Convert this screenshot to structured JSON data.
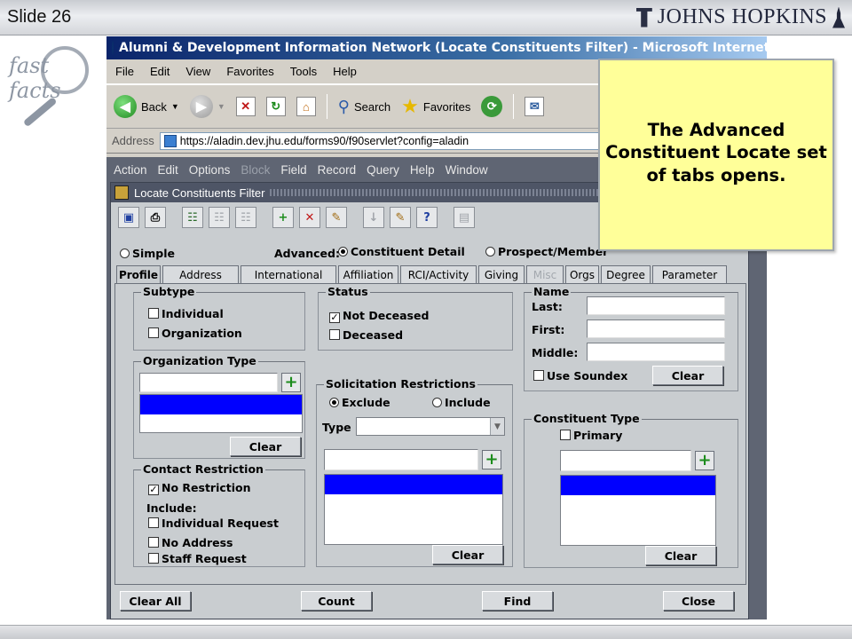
{
  "slide": {
    "number_label": "Slide 26",
    "brand": "JOHNS HOPKINS",
    "fastfacts": "fast facts"
  },
  "browser": {
    "title": "Alumni & Development Information Network (Locate Constituents Filter) - Microsoft Internet Explorer",
    "menu": [
      "File",
      "Edit",
      "View",
      "Favorites",
      "Tools",
      "Help"
    ],
    "toolbar": {
      "back": "Back",
      "search": "Search",
      "favorites": "Favorites"
    },
    "address_label": "Address",
    "url": "https://aladin.dev.jhu.edu/forms90/f90servlet?config=aladin"
  },
  "oracle": {
    "menu": [
      "Action",
      "Edit",
      "Options",
      "Block",
      "Field",
      "Record",
      "Query",
      "Help",
      "Window"
    ],
    "window_title": "Locate Constituents Filter",
    "mode": {
      "simple": "Simple",
      "advanced": "Advanced:",
      "constituent_detail": "Constituent Detail",
      "prospect": "Prospect/Member"
    },
    "tabs": [
      "Profile",
      "Address",
      "International",
      "Affiliation",
      "RCI/Activity",
      "Giving",
      "Misc",
      "Orgs",
      "Degree",
      "Parameter"
    ],
    "subtype": {
      "label": "Subtype",
      "individual": "Individual",
      "organization": "Organization"
    },
    "status": {
      "label": "Status",
      "not_deceased": "Not Deceased",
      "deceased": "Deceased"
    },
    "name": {
      "label": "Name",
      "last": "Last:",
      "first": "First:",
      "middle": "Middle:",
      "soundex": "Use Soundex",
      "clear": "Clear"
    },
    "org_type": {
      "label": "Organization Type",
      "clear": "Clear"
    },
    "solicitation": {
      "label": "Solicitation Restrictions",
      "exclude": "Exclude",
      "include": "Include",
      "type": "Type",
      "clear": "Clear"
    },
    "constituent_type": {
      "label": "Constituent Type",
      "primary": "Primary",
      "clear": "Clear"
    },
    "contact": {
      "label": "Contact Restriction",
      "no_restriction": "No Restriction",
      "include": "Include:",
      "individual_request": "Individual Request",
      "no_address": "No Address",
      "staff_request": "Staff Request"
    },
    "buttons": {
      "clear_all": "Clear All",
      "count": "Count",
      "find": "Find",
      "close": "Close"
    }
  },
  "callout": {
    "text": "The Advanced Constituent Locate set of tabs opens."
  },
  "colors": {
    "callout_bg": "#ffff99",
    "selection": "#0000ff",
    "oracle_bg": "#c9cdd0"
  }
}
